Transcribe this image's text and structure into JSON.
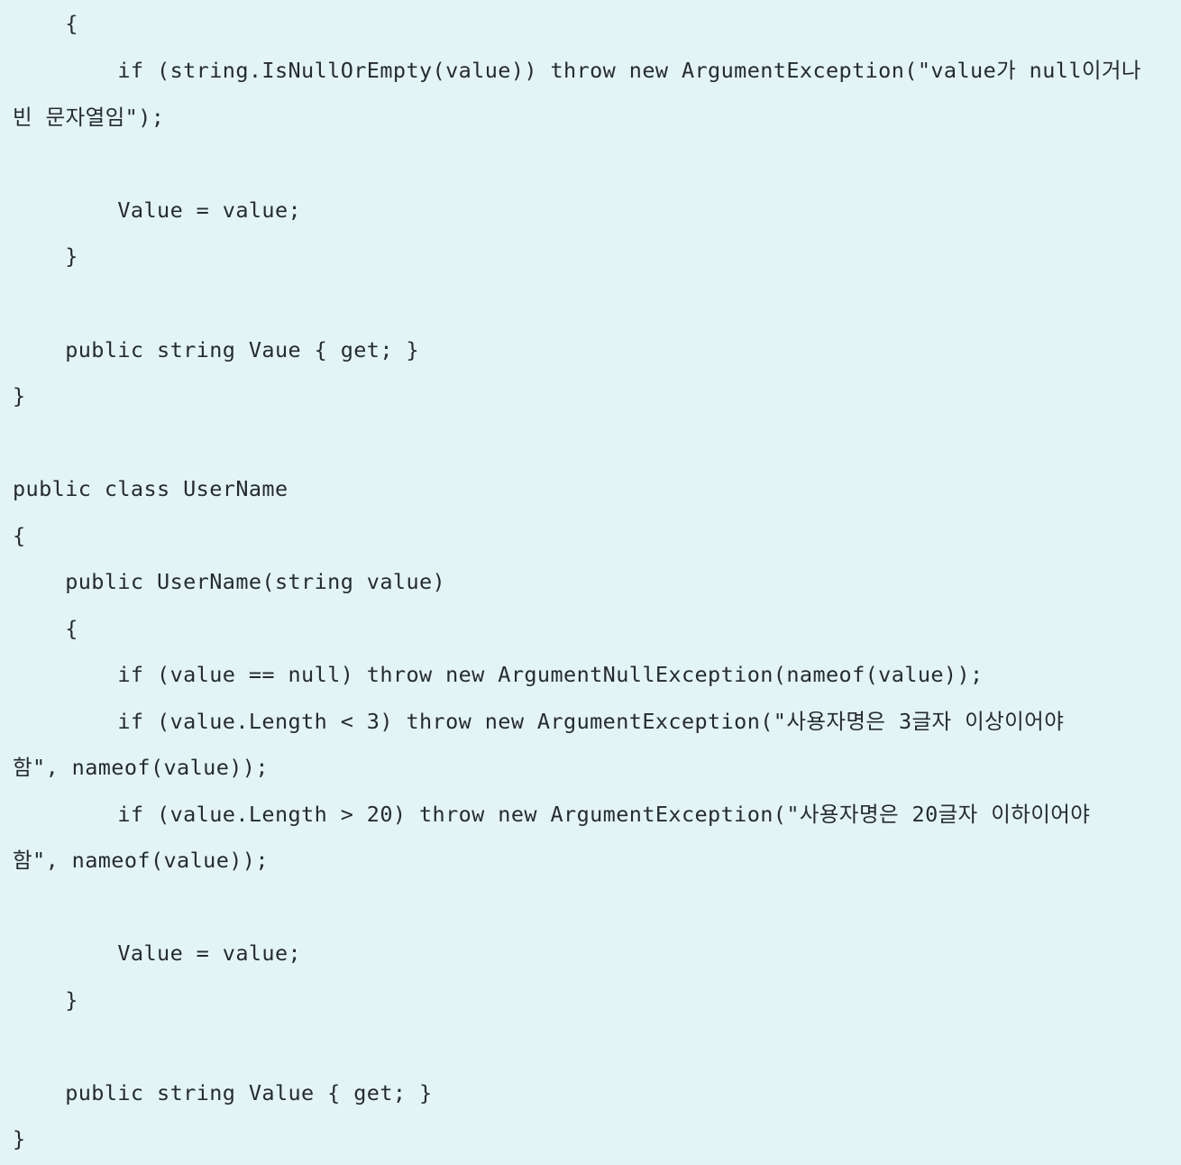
{
  "code": {
    "lines": [
      "    {",
      "        if (string.IsNullOrEmpty(value)) throw new ArgumentException(\"value가 null이거나",
      "빈 문자열임\");",
      "",
      "        Value = value;",
      "    }",
      "",
      "    public string Vaue { get; }",
      "}",
      "",
      "public class UserName",
      "{",
      "    public UserName(string value)",
      "    {",
      "        if (value == null) throw new ArgumentNullException(nameof(value));",
      "        if (value.Length < 3) throw new ArgumentException(\"사용자명은 3글자 이상이어야",
      "함\", nameof(value));",
      "        if (value.Length > 20) throw new ArgumentException(\"사용자명은 20글자 이하이어야",
      "함\", nameof(value));",
      "",
      "        Value = value;",
      "    }",
      "",
      "    public string Value { get; }",
      "}"
    ]
  }
}
